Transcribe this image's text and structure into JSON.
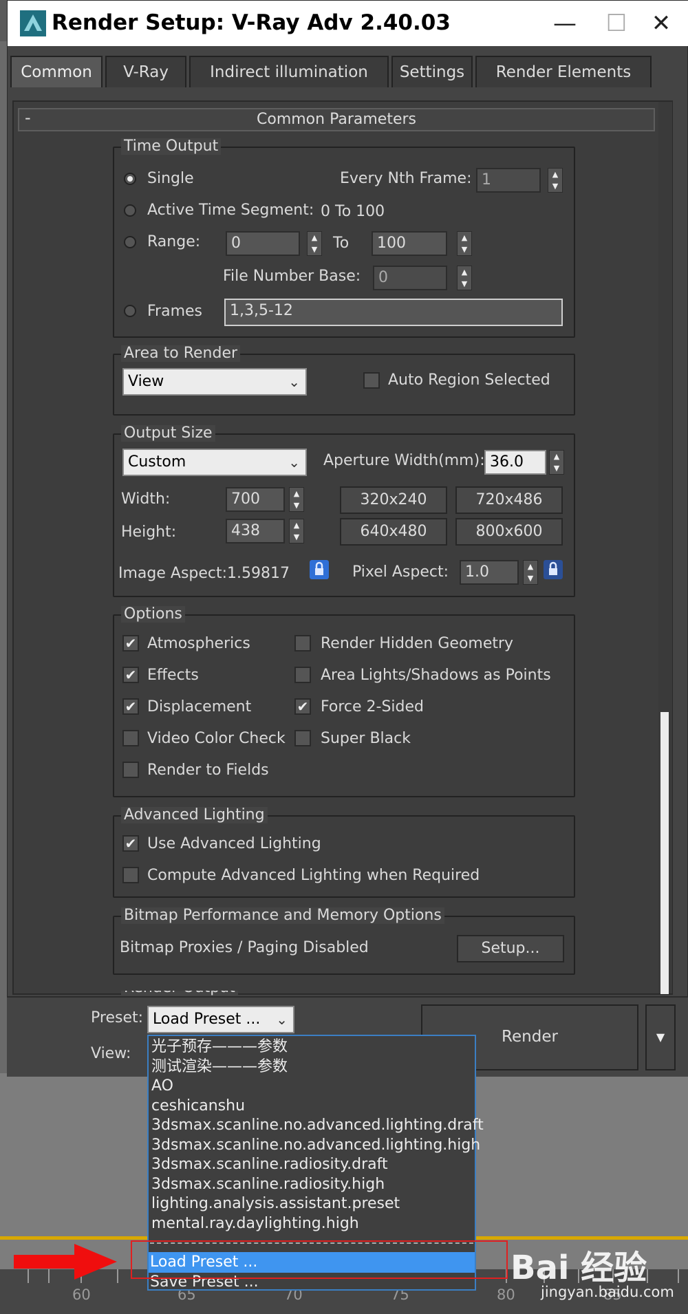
{
  "window": {
    "title": "Render Setup: V-Ray Adv 2.40.03",
    "minimize": "—",
    "maximize": "☐",
    "close": "✕"
  },
  "tabs": [
    {
      "label": "Common",
      "active": true
    },
    {
      "label": "V-Ray"
    },
    {
      "label": "Indirect illumination"
    },
    {
      "label": "Settings"
    },
    {
      "label": "Render Elements"
    }
  ],
  "rollout": {
    "collapse": "-",
    "title": "Common Parameters"
  },
  "time_output": {
    "group": "Time Output",
    "single": "Single",
    "every_nth_frame": "Every Nth Frame:",
    "every_nth_value": "1",
    "active_time_segment": "Active Time Segment:",
    "active_range": "0 To 100",
    "range": "Range:",
    "range_from": "0",
    "range_to_label": "To",
    "range_to": "100",
    "file_number_base": "File Number Base:",
    "file_number_value": "0",
    "frames": "Frames",
    "frames_value": "1,3,5-12",
    "selected": "Single"
  },
  "area_to_render": {
    "group": "Area to Render",
    "value": "View",
    "auto_region": "Auto Region Selected",
    "auto_region_checked": false
  },
  "output_size": {
    "group": "Output Size",
    "preset": "Custom",
    "aperture_label": "Aperture Width(mm):",
    "aperture_value": "36.0",
    "width_label": "Width:",
    "width_value": "700",
    "height_label": "Height:",
    "height_value": "438",
    "presets": [
      "320x240",
      "720x486",
      "640x480",
      "800x600"
    ],
    "image_aspect": "Image Aspect:1.59817",
    "pixel_aspect_label": "Pixel Aspect:",
    "pixel_aspect_value": "1.0"
  },
  "options": {
    "group": "Options",
    "items": [
      {
        "label": "Atmospherics",
        "checked": true
      },
      {
        "label": "Render Hidden Geometry",
        "checked": false
      },
      {
        "label": "Effects",
        "checked": true
      },
      {
        "label": "Area Lights/Shadows as Points",
        "checked": false
      },
      {
        "label": "Displacement",
        "checked": true
      },
      {
        "label": "Force 2-Sided",
        "checked": true
      },
      {
        "label": "Video Color Check",
        "checked": false
      },
      {
        "label": "Super Black",
        "checked": false
      },
      {
        "label": "Render to Fields",
        "checked": false
      }
    ]
  },
  "advanced_lighting": {
    "group": "Advanced Lighting",
    "use": "Use Advanced Lighting",
    "use_checked": true,
    "compute": "Compute Advanced Lighting when Required",
    "compute_checked": false
  },
  "bitmap": {
    "group": "Bitmap Performance and Memory Options",
    "status": "Bitmap Proxies / Paging Disabled",
    "setup": "Setup..."
  },
  "render_output": {
    "group": "Render Output"
  },
  "bottom": {
    "preset_label": "Preset:",
    "preset_value": "Load Preset ...",
    "view_label": "View:",
    "render": "Render",
    "render_arrow": "▼"
  },
  "dropdown": {
    "items": [
      "光子预存———参数",
      "测试渲染———参数",
      "AO",
      "ceshicanshu",
      "3dsmax.scanline.no.advanced.lighting.draft",
      "3dsmax.scanline.no.advanced.lighting.high",
      "3dsmax.scanline.radiosity.draft",
      "3dsmax.scanline.radiosity.high",
      "lighting.analysis.assistant.preset",
      "mental.ray.daylighting.high"
    ],
    "load": "Load Preset ...",
    "save": "Save Preset ..."
  },
  "timeline": {
    "labels": [
      "60",
      "65",
      "70",
      "75",
      "80",
      "85"
    ]
  },
  "watermark": {
    "logo": "Bai 经验",
    "sub": "jingyan.baidu.com"
  }
}
